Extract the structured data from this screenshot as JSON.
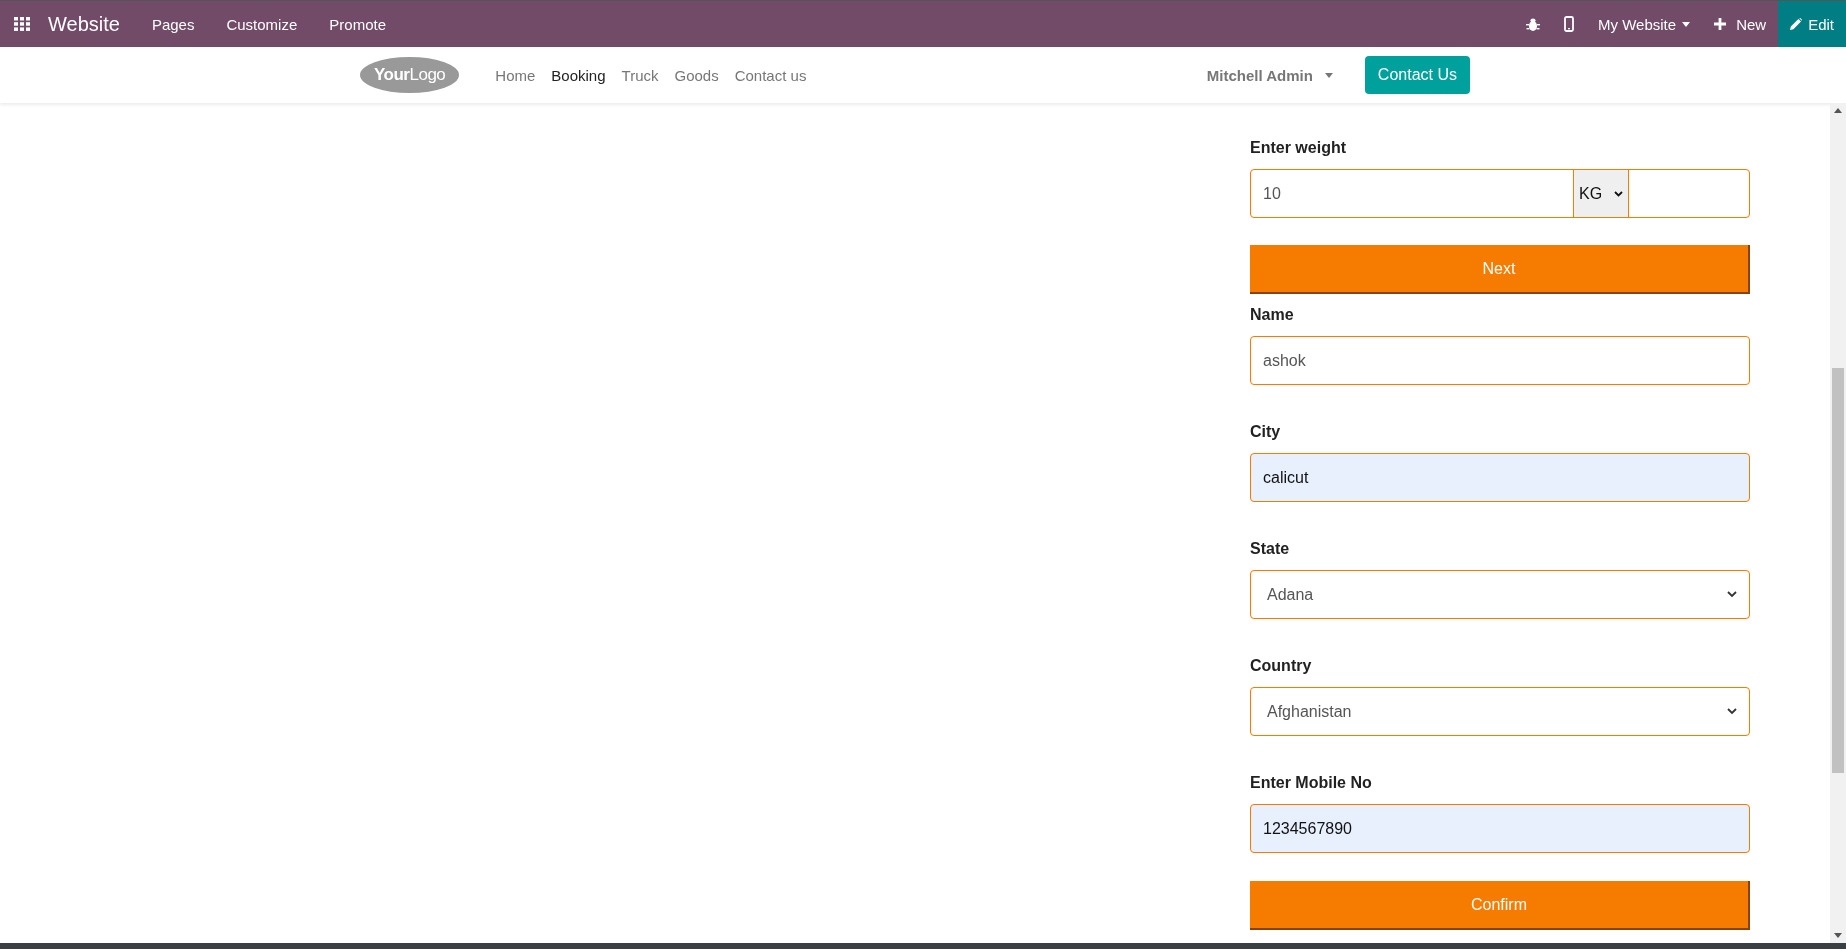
{
  "top_bar": {
    "app_title": "Website",
    "menu": [
      "Pages",
      "Customize",
      "Promote"
    ],
    "site_switcher": "My Website",
    "new_label": "New",
    "edit_label": "Edit"
  },
  "site_nav": {
    "logo": "**Your**Logo",
    "links": [
      {
        "label": "Home",
        "selected": false
      },
      {
        "label": "Booking",
        "selected": true
      },
      {
        "label": "Truck",
        "selected": false
      },
      {
        "label": "Goods",
        "selected": false
      },
      {
        "label": "Contact us",
        "selected": false
      }
    ],
    "user": "Mitchell Admin",
    "contact_button": "Contact Us"
  },
  "form": [
    {
      "kind": "weight",
      "label": "Enter weight",
      "value": "10",
      "unit": "KG"
    },
    {
      "kind": "button",
      "label": "Next"
    },
    {
      "kind": "text",
      "label": "Name",
      "value": "ashok",
      "autofilled": false
    },
    {
      "kind": "text",
      "label": "City",
      "value": "calicut",
      "autofilled": true
    },
    {
      "kind": "select",
      "label": "State",
      "value": "Adana"
    },
    {
      "kind": "select",
      "label": "Country",
      "value": "Afghanistan"
    },
    {
      "kind": "text",
      "label": "Enter Mobile No",
      "value": "1234567890",
      "autofilled": true
    },
    {
      "kind": "button",
      "label": "Confirm"
    }
  ]
}
